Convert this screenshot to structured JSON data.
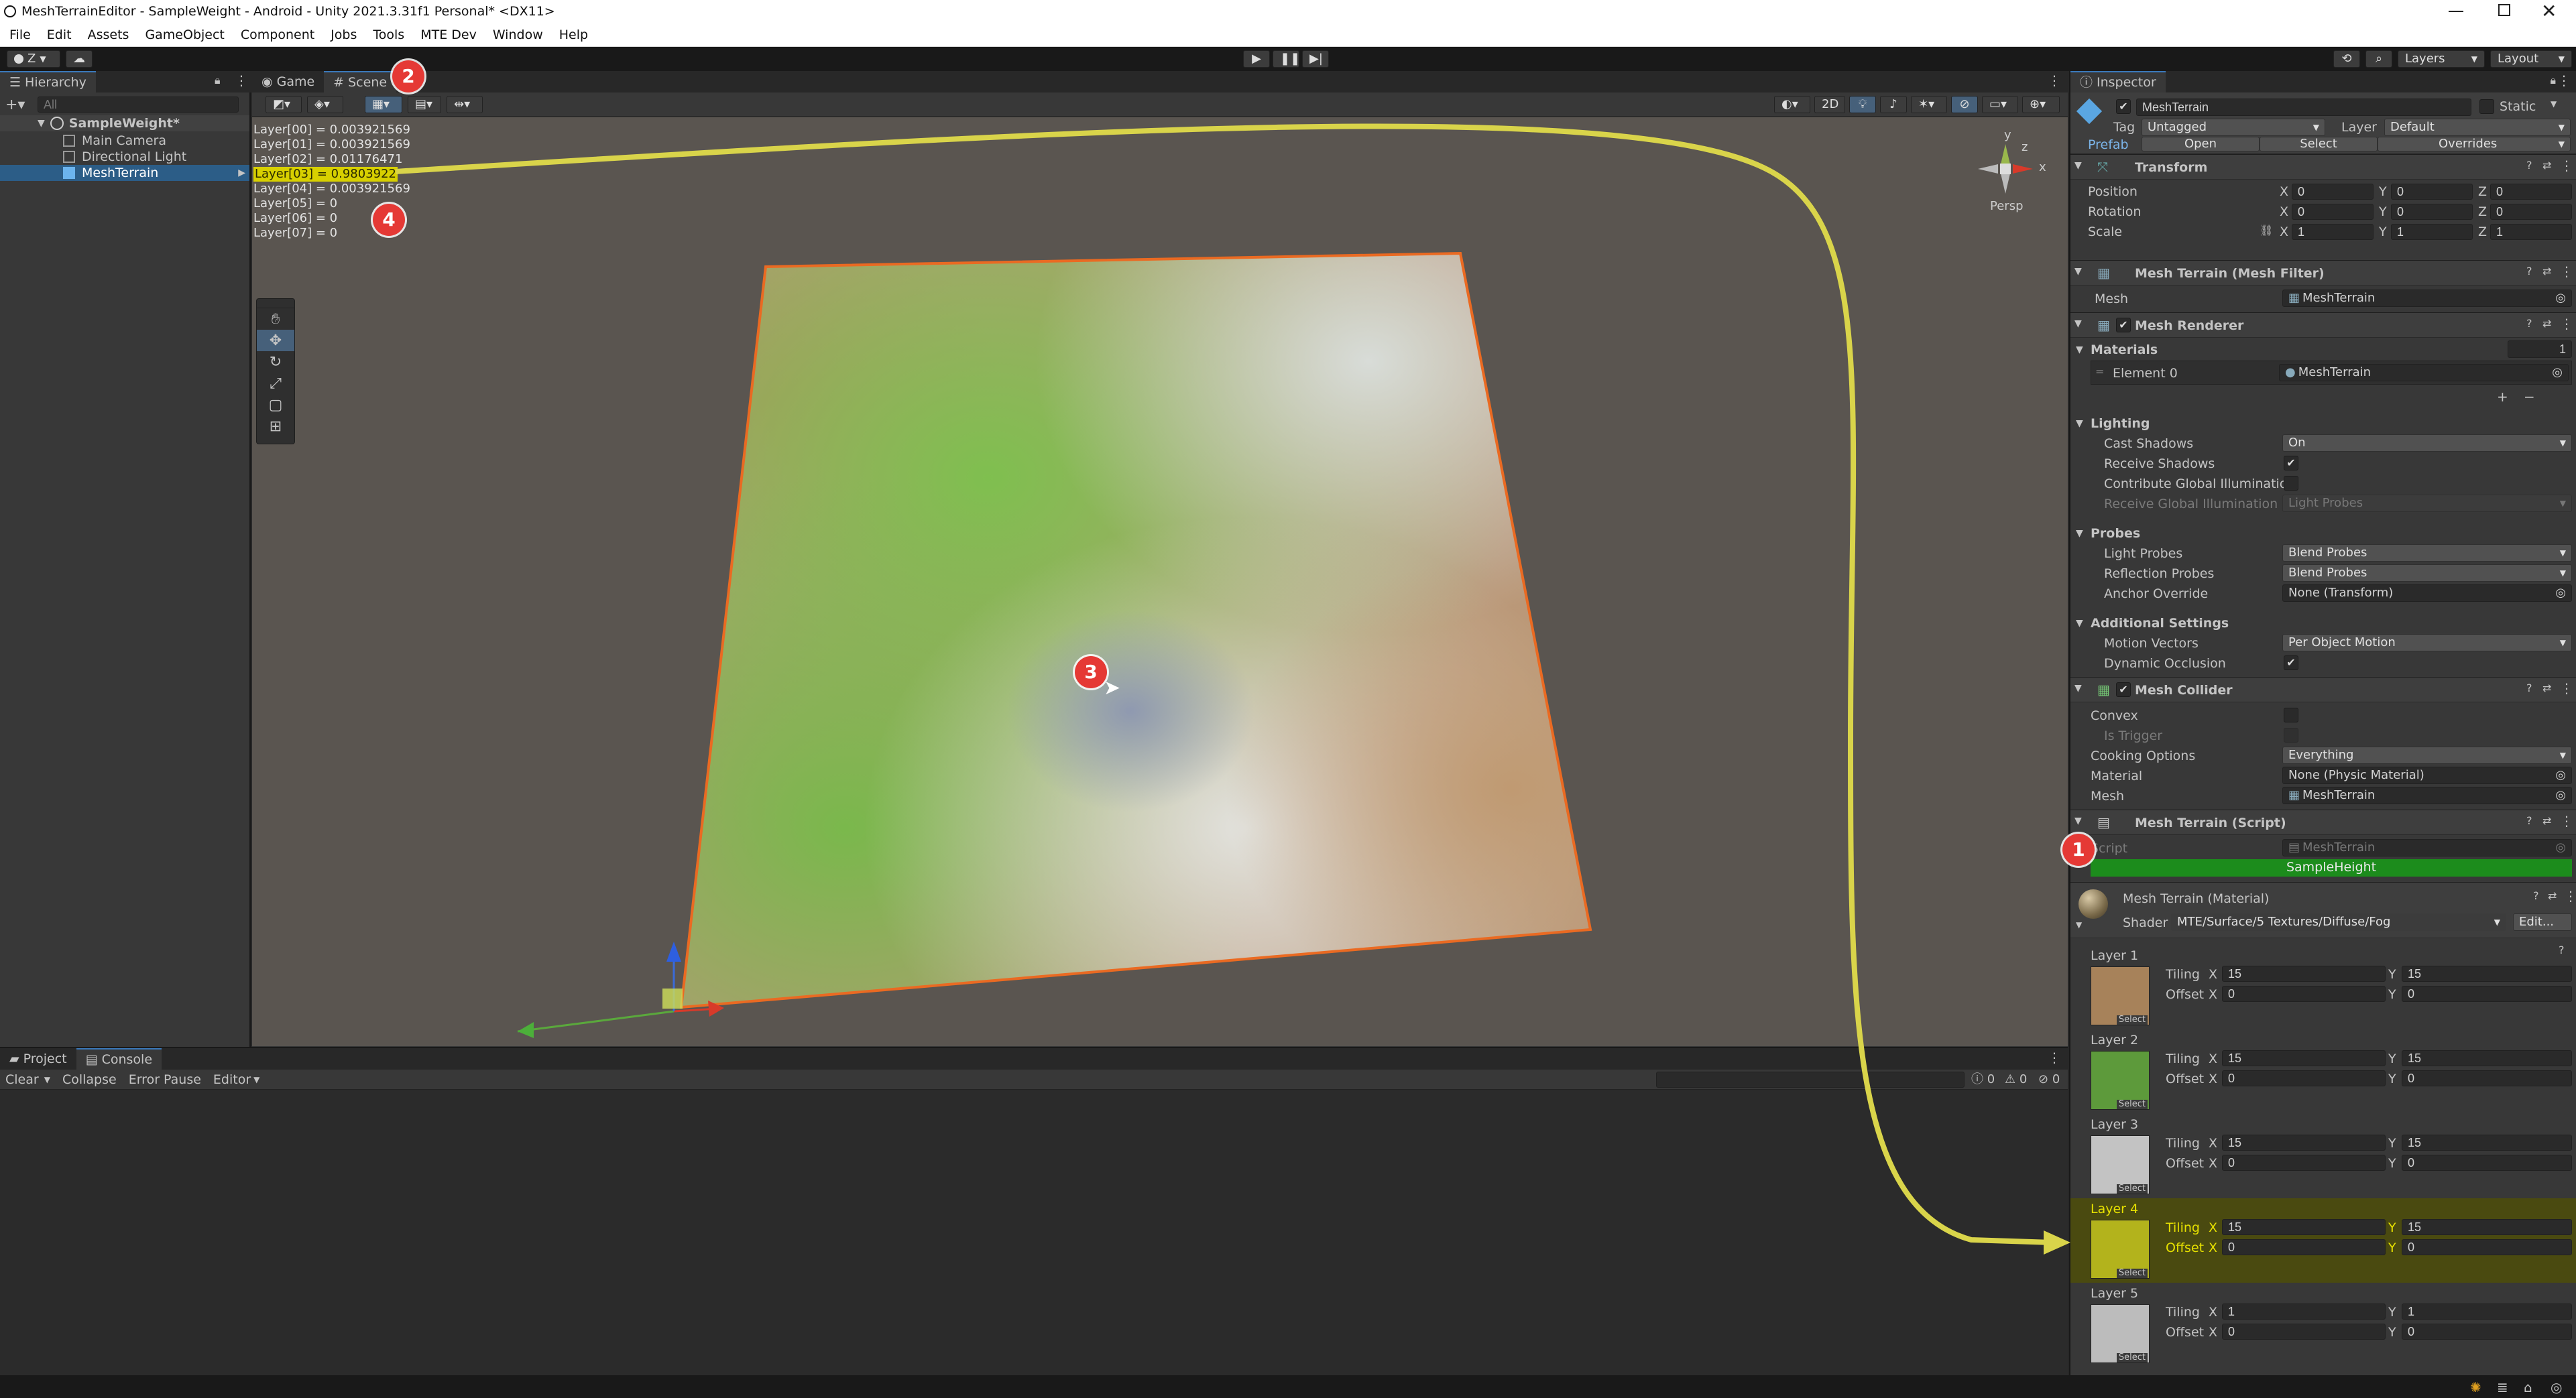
{
  "window": {
    "title": "MeshTerrainEditor - SampleWeight - Android - Unity 2021.3.31f1 Personal* <DX11>"
  },
  "menu": [
    "File",
    "Edit",
    "Assets",
    "GameObject",
    "Component",
    "Jobs",
    "Tools",
    "MTE Dev",
    "Window",
    "Help"
  ],
  "toolbar": {
    "account": "Z",
    "layers": "Layers",
    "layout": "Layout"
  },
  "hierarchy": {
    "tab": "Hierarchy",
    "search_placeholder": "All",
    "scene": "SampleWeight*",
    "items": [
      "Main Camera",
      "Directional Light",
      "MeshTerrain"
    ]
  },
  "scene_tabs": {
    "game": "Game",
    "scene": "Scene"
  },
  "scene_view": {
    "mode_2d": "2D",
    "persp": "Persp",
    "gizmo_y": "y",
    "gizmo_z": "z",
    "gizmo_x": "x",
    "layers": [
      "Layer[00] = 0.003921569",
      "Layer[01] = 0.003921569",
      "Layer[02] = 0.01176471",
      "Layer[03] = 0.9803922",
      "Layer[04] = 0.003921569",
      "Layer[05] = 0",
      "Layer[06] = 0",
      "Layer[07] = 0"
    ]
  },
  "console": {
    "tab_project": "Project",
    "tab_console": "Console",
    "clear": "Clear",
    "collapse": "Collapse",
    "error_pause": "Error Pause",
    "editor": "Editor",
    "count_log": "0",
    "count_warn": "0",
    "count_error": "0"
  },
  "inspector": {
    "tab": "Inspector",
    "object_name": "MeshTerrain",
    "static": "Static",
    "tag_label": "Tag",
    "tag": "Untagged",
    "layer_label": "Layer",
    "layer": "Default",
    "prefab_label": "Prefab",
    "open": "Open",
    "select": "Select",
    "overrides": "Overrides",
    "transform": {
      "title": "Transform",
      "position": "Position",
      "rotation": "Rotation",
      "scale": "Scale",
      "pos": [
        "0",
        "0",
        "0"
      ],
      "rot": [
        "0",
        "0",
        "0"
      ],
      "scl": [
        "1",
        "1",
        "1"
      ]
    },
    "mesh_filter": {
      "title": "Mesh Terrain (Mesh Filter)",
      "mesh_label": "Mesh",
      "mesh": "MeshTerrain"
    },
    "mesh_renderer": {
      "title": "Mesh Renderer",
      "materials": "Materials",
      "materials_count": "1",
      "element0": "Element 0",
      "element0_value": "MeshTerrain",
      "lighting": "Lighting",
      "cast_shadows": "Cast Shadows",
      "cast_shadows_value": "On",
      "receive_shadows": "Receive Shadows",
      "contribute_gi": "Contribute Global Illumination",
      "receive_gi": "Receive Global Illumination",
      "receive_gi_value": "Light Probes",
      "probes": "Probes",
      "light_probes": "Light Probes",
      "light_probes_value": "Blend Probes",
      "reflection_probes": "Reflection Probes",
      "reflection_probes_value": "Blend Probes",
      "anchor_override": "Anchor Override",
      "anchor_override_value": "None (Transform)",
      "additional": "Additional Settings",
      "motion_vectors": "Motion Vectors",
      "motion_vectors_value": "Per Object Motion",
      "dynamic_occlusion": "Dynamic Occlusion"
    },
    "mesh_collider": {
      "title": "Mesh Collider",
      "convex": "Convex",
      "is_trigger": "Is Trigger",
      "cooking": "Cooking Options",
      "cooking_value": "Everything",
      "material": "Material",
      "material_value": "None (Physic Material)",
      "mesh": "Mesh",
      "mesh_value": "MeshTerrain"
    },
    "script": {
      "title": "Mesh Terrain (Script)",
      "script_label": "Script",
      "script_value": "MeshTerrain",
      "bar": "SampleHeight",
      "bar_color": "#1c8c1c"
    },
    "material": {
      "title": "Mesh Terrain (Material)",
      "shader_label": "Shader",
      "shader": "MTE/Surface/5 Textures/Diffuse/Fog",
      "edit": "Edit...",
      "layers": [
        {
          "name": "Layer 1",
          "tiling": [
            "15",
            "15"
          ],
          "offset": [
            "0",
            "0"
          ],
          "color": "#a7825a"
        },
        {
          "name": "Layer 2",
          "tiling": [
            "15",
            "15"
          ],
          "offset": [
            "0",
            "0"
          ],
          "color": "#5d9a3b"
        },
        {
          "name": "Layer 3",
          "tiling": [
            "15",
            "15"
          ],
          "offset": [
            "0",
            "0"
          ],
          "color": "#c3c3c3"
        },
        {
          "name": "Layer 4",
          "tiling": [
            "15",
            "15"
          ],
          "offset": [
            "0",
            "0"
          ],
          "color": "#b3b31c"
        },
        {
          "name": "Layer 5",
          "tiling": [
            "1",
            "1"
          ],
          "offset": [
            "0",
            "0"
          ],
          "color": "#bcbcbc"
        }
      ],
      "tiling": "Tiling",
      "offset": "Offset",
      "x": "X",
      "y": "Y",
      "select_label": "Select"
    }
  },
  "markers": [
    "1",
    "2",
    "3",
    "4"
  ],
  "colors": {
    "highlight": "#e6e000",
    "arrow": "#d9d44a",
    "marker": "#e53935",
    "selection": "#2c5d87"
  }
}
